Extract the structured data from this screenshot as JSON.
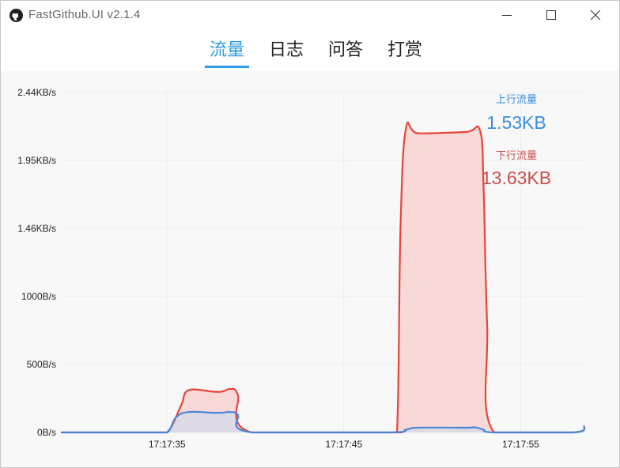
{
  "window": {
    "title": "FastGithub.UI v2.1.4",
    "icons": {
      "app": "github-octocat-icon",
      "minimize": "minimize-icon",
      "maximize": "maximize-icon",
      "close": "close-icon"
    }
  },
  "tabs": [
    {
      "label": "流量",
      "active": true
    },
    {
      "label": "日志",
      "active": false
    },
    {
      "label": "问答",
      "active": false
    },
    {
      "label": "打赏",
      "active": false
    }
  ],
  "stats": {
    "upload": {
      "label": "上行流量",
      "value": "1.53KB",
      "color": "#3b8de0"
    },
    "download": {
      "label": "下行流量",
      "value": "13.63KB",
      "color": "#c9504c"
    }
  },
  "colors": {
    "accent": "#2f9bea",
    "upload_line": "#4a86d6",
    "download_line": "#e8443a",
    "download_fill": "#f7d9d8"
  },
  "chart_data": {
    "type": "area",
    "title": "",
    "xlabel": "",
    "ylabel": "",
    "y_unit": "B/s",
    "ylim": [
      0,
      2500
    ],
    "yticks": [
      0,
      500,
      1000,
      1500,
      2000,
      2500
    ],
    "ytick_labels": [
      "0B/s",
      "500B/s",
      "1000B/s",
      "1.46KB/s",
      "1.95KB/s",
      "2.44KB/s"
    ],
    "x_range_seconds": [
      29.0,
      58.6
    ],
    "xticks": [
      35,
      45,
      55
    ],
    "xtick_labels": [
      "17:17:35",
      "17:17:45",
      "17:17:55"
    ],
    "grid": true,
    "series": [
      {
        "key": "download",
        "x": [
          29.0,
          34.0,
          35.0,
          35.8,
          36.2,
          37.6,
          38.1,
          38.6,
          39.0,
          39.8,
          47.5,
          48.0,
          48.2,
          48.5,
          49.2,
          51.9,
          52.7,
          52.9,
          53.1,
          53.5,
          58.0,
          58.6
        ],
        "values": [
          0,
          0,
          0,
          200,
          310,
          300,
          300,
          320,
          280,
          0,
          0,
          0,
          1500,
          2230,
          2200,
          2210,
          2220,
          1800,
          800,
          0,
          0,
          50
        ]
      },
      {
        "key": "upload",
        "x": [
          29.0,
          34.0,
          35.0,
          35.5,
          36.2,
          37.6,
          38.1,
          38.6,
          39.0,
          39.8,
          47.5,
          48.5,
          49.2,
          51.9,
          52.4,
          52.9,
          53.5,
          58.0,
          58.6
        ],
        "values": [
          0,
          0,
          0,
          110,
          150,
          145,
          145,
          150,
          130,
          0,
          0,
          20,
          35,
          35,
          38,
          20,
          0,
          0,
          50
        ]
      }
    ]
  }
}
